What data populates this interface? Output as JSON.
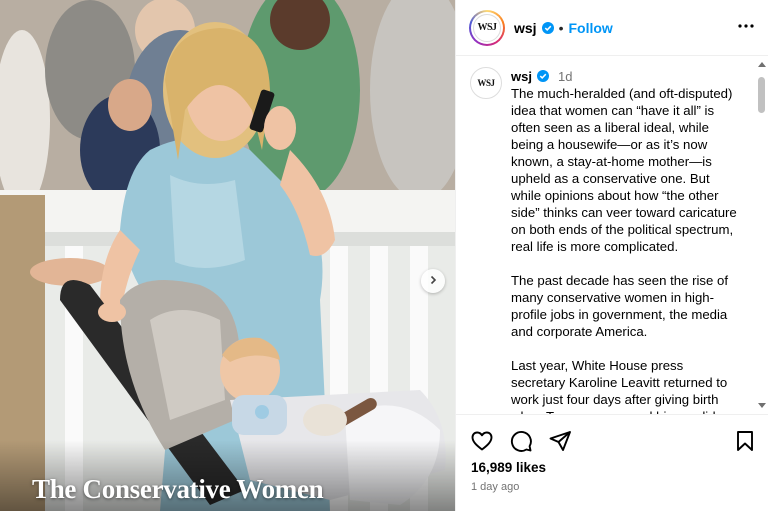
{
  "photo": {
    "caption": "The Conservative Women"
  },
  "post": {
    "author": {
      "handle": "wsj",
      "avatar_text": "WSJ",
      "verified": true
    },
    "follow_label": "Follow",
    "header_separator": "•",
    "comment": {
      "handle": "wsj",
      "time": "1d",
      "paragraphs": [
        "The much-heralded (and oft-disputed) idea that women can “have it all” is often seen as a liberal ideal, while being a housewife—or as it’s now known, a stay-at-home mother—is upheld as a conservative one. But while opinions about how “the other side” thinks can veer toward caricature on both ends of the political spectrum, real life is more complicated.",
        "The past decade has seen the rise of many conservative women in high-profile jobs in government, the media and corporate America.",
        "Last year, White House press secretary Karoline Leavitt returned to work just four days after giving birth when Trump announced his candidacy."
      ]
    },
    "likes": "16,989 likes",
    "posted_ago": "1 day ago"
  },
  "icons": {
    "verified": "verified-badge-icon",
    "more": "more-options-icon",
    "like": "heart-icon",
    "comment": "comment-icon",
    "share": "share-icon",
    "save": "bookmark-icon",
    "next": "chevron-right-icon"
  },
  "colors": {
    "follow": "#0095f6",
    "verified": "#0095f6",
    "secondary_text": "#737373",
    "dress": "#9cc8d8"
  }
}
